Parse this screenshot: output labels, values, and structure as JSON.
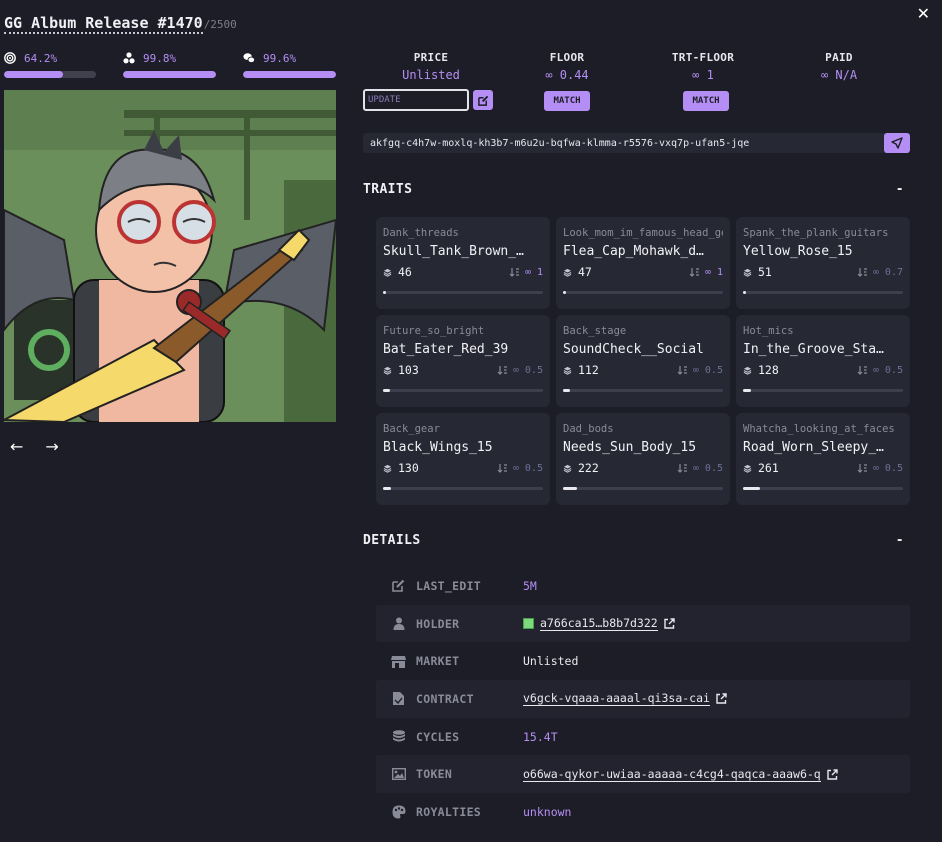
{
  "header": {
    "title": "GG Album Release #1470",
    "supply": "/2500"
  },
  "stats": [
    {
      "icon": "target-icon",
      "value": "64.2%",
      "fill": 64.2
    },
    {
      "icon": "shapes-icon",
      "value": "99.8%",
      "fill": 99.8
    },
    {
      "icon": "chat-bubbles-icon",
      "value": "99.6%",
      "fill": 99.6
    }
  ],
  "market": {
    "price": {
      "label": "PRICE",
      "value": "Unlisted"
    },
    "floor": {
      "label": "FLOOR",
      "value": "∞ 0.44"
    },
    "trt_floor": {
      "label": "TRT-FLOOR",
      "value": "∞ 1"
    },
    "paid": {
      "label": "PAID",
      "value": "∞ N/A"
    },
    "update_placeholder": "UPDATE",
    "match_label": "MATCH"
  },
  "address": "akfgq-c4h7w-moxlq-kh3b7-m6u2u-bqfwa-klmma-r5576-vxq7p-ufan5-jqe",
  "traits_section": {
    "title": "TRAITS",
    "toggle": "-"
  },
  "traits": [
    {
      "category": "Dank_threads",
      "value": "Skull_Tank_Brown_…",
      "count": "46",
      "floor": "∞ 1",
      "floor_hl": true,
      "rarity": 0.018
    },
    {
      "category": "Look_mom_im_famous_head_gear",
      "value": "Flea_Cap_Mohawk_d…",
      "count": "47",
      "floor": "∞ 1",
      "floor_hl": true,
      "rarity": 0.019
    },
    {
      "category": "Spank_the_plank_guitars",
      "value": "Yellow_Rose_15",
      "count": "51",
      "floor": "∞ 0.7",
      "floor_hl": false,
      "rarity": 0.02
    },
    {
      "category": "Future_so_bright",
      "value": "Bat_Eater_Red_39",
      "count": "103",
      "floor": "∞ 0.5",
      "floor_hl": false,
      "rarity": 0.041
    },
    {
      "category": "Back_stage",
      "value": "SoundCheck__Social",
      "count": "112",
      "floor": "∞ 0.5",
      "floor_hl": false,
      "rarity": 0.045
    },
    {
      "category": "Hot_mics",
      "value": "In_the_Groove_Sta…",
      "count": "128",
      "floor": "∞ 0.5",
      "floor_hl": false,
      "rarity": 0.051
    },
    {
      "category": "Back_gear",
      "value": "Black_Wings_15",
      "count": "130",
      "floor": "∞ 0.5",
      "floor_hl": false,
      "rarity": 0.052
    },
    {
      "category": "Dad_bods",
      "value": "Needs_Sun_Body_15",
      "count": "222",
      "floor": "∞ 0.5",
      "floor_hl": false,
      "rarity": 0.089
    },
    {
      "category": "Whatcha_looking_at_faces",
      "value": "Road_Worn_Sleepy_…",
      "count": "261",
      "floor": "∞ 0.5",
      "floor_hl": false,
      "rarity": 0.104
    }
  ],
  "details_section": {
    "title": "DETAILS",
    "toggle": "-"
  },
  "details": [
    {
      "icon": "edit-icon",
      "label": "LAST_EDIT",
      "value": "5M",
      "style": "purple"
    },
    {
      "icon": "user-icon",
      "label": "HOLDER",
      "value": "a766ca15…b8b7d322",
      "style": "link"
    },
    {
      "icon": "store-icon",
      "label": "MARKET",
      "value": "Unlisted",
      "style": "plain"
    },
    {
      "icon": "file-icon",
      "label": "CONTRACT",
      "value": "v6gck-vqaaa-aaaal-qi3sa-cai",
      "style": "link"
    },
    {
      "icon": "database-icon",
      "label": "CYCLES",
      "value": "15.4T",
      "style": "purple"
    },
    {
      "icon": "image-icon",
      "label": "TOKEN",
      "value": "o66wa-qykor-uwiaa-aaaaa-c4cg4-qaqca-aaaw6-q",
      "style": "link"
    },
    {
      "icon": "palette-icon",
      "label": "ROYALTIES",
      "value": "unknown",
      "style": "purple"
    }
  ]
}
